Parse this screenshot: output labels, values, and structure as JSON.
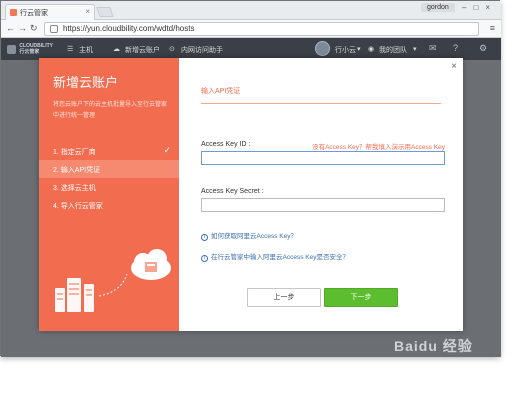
{
  "browser": {
    "tab_title": "行云管家",
    "user_badge": "gordon",
    "url": "https://yun.cloudbility.com/wdtd/hosts"
  },
  "appbar": {
    "logo_text": "CLOUDBILITY\n行云管家",
    "menu_label": "主机",
    "add_account": "新增云账户",
    "network_helper": "内网访问助手",
    "user_name": "行小云",
    "team_label": "我的团队"
  },
  "modal": {
    "title": "新增云账户",
    "description": "将您云账户下的云主机批量导入至行云管家中进行统一管理",
    "steps": [
      {
        "label": "1. 指定云厂商",
        "done": true
      },
      {
        "label": "2. 输入API凭证",
        "active": true
      },
      {
        "label": "3. 选择云主机"
      },
      {
        "label": "4. 导入行云管家"
      }
    ],
    "section_title": "输入API凭证",
    "access_key_id_label": "Access Key ID :",
    "access_key_id_hint": "没有Access Key？帮我填入演示用Access Key",
    "access_key_id_value": "",
    "access_key_secret_label": "Access Key Secret :",
    "access_key_secret_value": "",
    "help_link_1": "如何获取阿里云Access Key？",
    "help_link_2": "在行云管家中输入阿里云Access Key是否安全？",
    "prev_button": "上一步",
    "next_button": "下一步"
  },
  "watermark": "Baidu 经验",
  "colors": {
    "accent": "#f26c4f",
    "primary_button": "#5cbd2e",
    "link": "#3a6fb0"
  }
}
